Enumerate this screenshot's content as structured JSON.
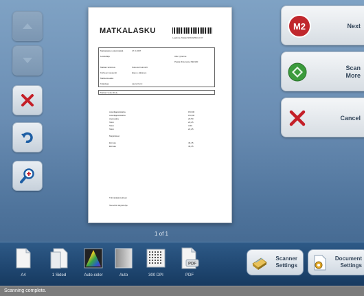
{
  "document": {
    "title": "MATKALASKU",
    "header_right": "Laatimis-/Tekijä  SPACETECH OY",
    "field_labels": [
      "Matkalaskun päivämäärä",
      "Laskuttaja",
      "Matkan tarkoitus",
      "Kohteen kaupunki",
      "Matkustusaika",
      "Kuljettaja",
      "Matkan kuluerittely"
    ],
    "field_values": [
      "17.3.2007",
      "Aku Lyhenne",
      "Pekka Ristorante PE8100",
      "Kokous Insinöörit",
      "Espoo Jalkanen",
      "Laura Korvi"
    ],
    "lines_left": [
      "Autoilijapäiväraha",
      "Autoilijapäiväraha",
      "Ateriaraha",
      "Taksi",
      "Taksi",
      "Taksi",
      "",
      "Majoitukset",
      "",
      "Eiinnas",
      "Eiinnas"
    ],
    "lines_right": [
      "150,00",
      "150,00",
      "20,50",
      "20,25",
      "3,50",
      "22,25",
      "",
      "",
      "",
      "46,45",
      "46,45"
    ],
    "footer1": "Tuhmikkäät kulttuur",
    "footer2": "Sivuvärin käyttöohje"
  },
  "page_counter": "1 of 1",
  "actions": {
    "next": "Next",
    "scan_more": [
      "Scan",
      "More"
    ],
    "cancel": "Cancel"
  },
  "toolbar": {
    "size": "A4",
    "sides": "1 Sided",
    "color": "Auto-color",
    "mode": "Auto",
    "dpi": "300 DPI",
    "format": "PDF",
    "scanner_settings": [
      "Scanner",
      "Settings"
    ],
    "document_settings": [
      "Document",
      "Settings"
    ]
  },
  "icons": {
    "m2_badge": "M2",
    "pdf_tag": "PDF",
    "color_accent": "#c0272d",
    "scan_green": "#3b9b3c",
    "brand_blue": "#2e5a87"
  },
  "status": "Scanning complete."
}
